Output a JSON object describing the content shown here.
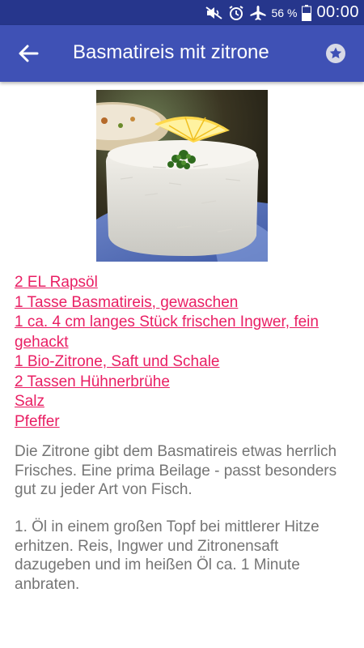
{
  "status_bar": {
    "battery_percent": "56 %",
    "time": "00:00",
    "icons": [
      "mute-icon",
      "alarm-icon",
      "airplane-mode-icon",
      "battery-icon"
    ]
  },
  "app_bar": {
    "title": "Basmatireis mit zitrone",
    "back_icon": "arrow-back-icon",
    "favorite_icon": "star-icon"
  },
  "recipe": {
    "image_alt": "Basmatireis mit Zitrone",
    "ingredients": [
      "2 EL Rapsöl",
      "1 Tasse Basmatireis, gewaschen",
      "1 ca. 4 cm langes Stück frischen Ingwer, fein gehackt",
      "1 Bio-Zitrone, Saft und Schale",
      "2 Tassen Hühnerbrühe",
      "Salz",
      "Pfeffer"
    ],
    "description": "Die Zitrone gibt dem Basmatireis etwas herrlich Frisches. Eine prima Beilage - passt besonders gut zu jeder Art von Fisch.",
    "step_1": "1. Öl in einem großen Topf bei mittlerer Hitze erhitzen. Reis, Ingwer und Zitronensaft dazugeben und im heißen Öl ca. 1 Minute anbraten."
  },
  "colors": {
    "status_bar": "#26368c",
    "app_bar": "#3f51b5",
    "ingredient_link": "#e91e63",
    "body_text": "#757575"
  }
}
